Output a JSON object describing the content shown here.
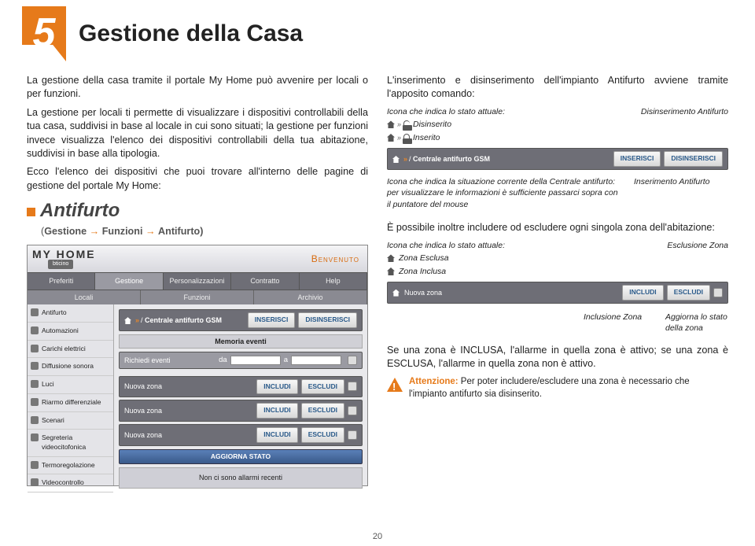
{
  "chapter": {
    "number": "5",
    "title": "Gestione della Casa"
  },
  "left": {
    "p1": "La gestione della casa tramite il portale My Home può avvenire per locali o per funzioni.",
    "p2": "La gestione per locali ti permette di visualizzare i dispositivi controllabili della tua casa, suddivisi in base al locale in cui sono situati; la gestione per funzioni invece visualizza l'elenco dei dispositivi controllabili della tua abitazione, suddivisi in base alla tipologia.",
    "p3": "Ecco l'elenco dei dispositivi che puoi trovare all'interno delle pagine di gestione del portale My Home:",
    "antifurto_title": "Antifurto",
    "breadcrumb": {
      "open": "(",
      "g": "Gestione",
      "f": "Funzioni",
      "a": "Antifurto)",
      "arrow": "→"
    }
  },
  "ui": {
    "logo": "MY HOME",
    "sublogo": "bticino",
    "benvenuto": "Benvenuto",
    "menu": [
      "Preferiti",
      "Gestione",
      "Personalizzazioni",
      "Contratto",
      "Help"
    ],
    "submenu": [
      "Locali",
      "Funzioni",
      "Archivio"
    ],
    "sidebar": [
      "Antifurto",
      "Automazioni",
      "Carichi elettrici",
      "Diffusione sonora",
      "Luci",
      "Riarmo differenziale",
      "Scenari",
      "Segreteria videocitofonica",
      "Termoregolazione",
      "Videocontrollo"
    ],
    "strip_crumbs_label": "Centrale antifurto GSM",
    "inserisci": "INSERISCI",
    "disinserisci": "DISINSERISCI",
    "memoria": "Memoria eventi",
    "richiedi": "Richiedi eventi",
    "da": "da",
    "a": "a",
    "nuova_zona": "Nuova zona",
    "includi": "INCLUDI",
    "escludi": "ESCLUDI",
    "aggiorna": "AGGIORNA STATO",
    "noalarm": "Non ci sono allarmi recenti"
  },
  "right": {
    "p1": "L'inserimento e disinserimento dell'impianto Antifurto avviene tramite l'apposito comando:",
    "label_state": "Icona che indica lo stato attuale:",
    "disins_label": "Disinserimento Antifurto",
    "disinserito": "Disinserito",
    "inserito": "Inserito",
    "label_situazione": "Icona che indica la situazione corrente della Centrale antifurto: per visualizzare le informazioni è sufficiente passarci sopra con il puntatore del mouse",
    "ins_label": "Inserimento Antifurto",
    "p2": "È possibile inoltre includere od escludere ogni singola zona dell'abitazione:",
    "label_state2": "Icona che indica lo stato attuale:",
    "escl_label": "Esclusione Zona",
    "zona_esclusa": "Zona Esclusa",
    "zona_inclusa": "Zona Inclusa",
    "inclusione": "Inclusione Zona",
    "aggiorna_lbl": "Aggiorna lo stato della zona",
    "p3": "Se una zona è INCLUSA, l'allarme in quella zona è attivo; se una zona è ESCLUSA, l'allarme in quella zona non è attivo.",
    "warn_lead": "Attenzione:",
    "warn_body": " Per poter includere/escludere una zona è necessario che l'impianto antifurto sia disinserito."
  },
  "page_number": "20"
}
